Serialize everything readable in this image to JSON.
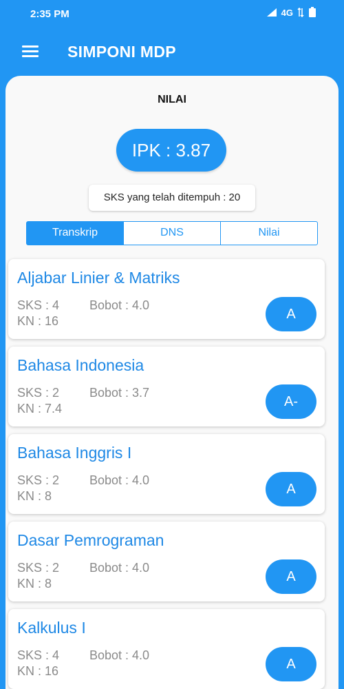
{
  "status_bar": {
    "time": "2:35 PM",
    "network": "4G"
  },
  "app_bar": {
    "title": "SIMPONI MDP",
    "menu_icon": "hamburger-menu-icon"
  },
  "page": {
    "title": "NILAI",
    "ipk": "IPK : 3.87",
    "sks_total": "SKS yang telah ditempuh : 20"
  },
  "tabs": [
    {
      "label": "Transkrip",
      "active": true
    },
    {
      "label": "DNS",
      "active": false
    },
    {
      "label": "Nilai",
      "active": false
    }
  ],
  "courses": [
    {
      "name": "Aljabar Linier & Matriks",
      "sks": "SKS : 4",
      "bobot": "Bobot : 4.0",
      "kn": "KN : 16",
      "grade": "A"
    },
    {
      "name": "Bahasa Indonesia",
      "sks": "SKS : 2",
      "bobot": "Bobot : 3.7",
      "kn": "KN : 7.4",
      "grade": "A-"
    },
    {
      "name": "Bahasa Inggris I",
      "sks": "SKS : 2",
      "bobot": "Bobot : 4.0",
      "kn": "KN : 8",
      "grade": "A"
    },
    {
      "name": "Dasar Pemrograman",
      "sks": "SKS : 2",
      "bobot": "Bobot : 4.0",
      "kn": "KN : 8",
      "grade": "A"
    },
    {
      "name": "Kalkulus I",
      "sks": "SKS : 4",
      "bobot": "Bobot : 4.0",
      "kn": "KN : 16",
      "grade": "A"
    }
  ],
  "colors": {
    "primary": "#2196F3",
    "course_name": "#1E88E5",
    "muted_text": "#8a8a8a",
    "sheet_bg": "#f9f9f9"
  }
}
